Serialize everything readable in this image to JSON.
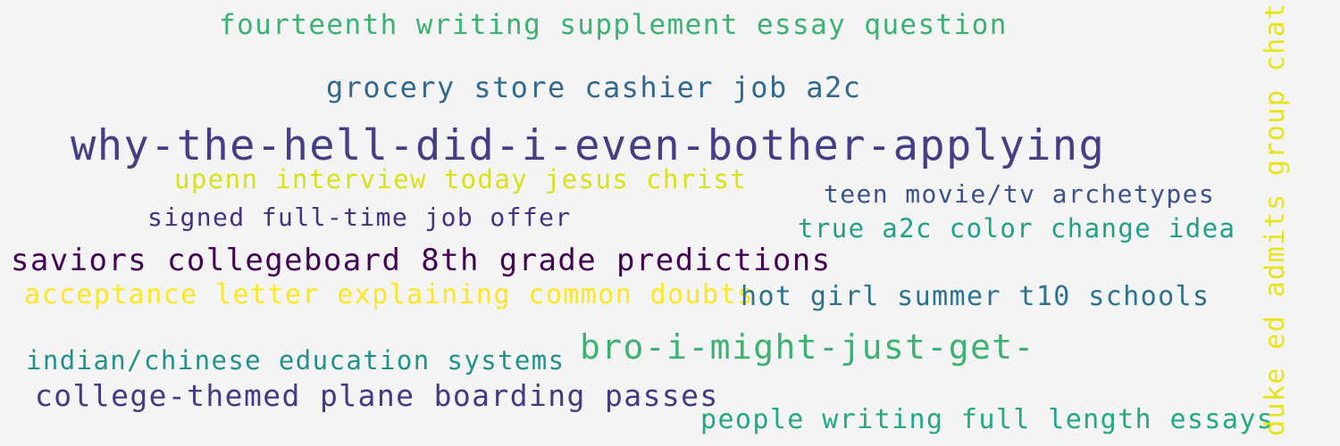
{
  "words": [
    {
      "text": "fourteenth writing supplement essay question",
      "color": "#3bb273"
    },
    {
      "text": "grocery store cashier job a2c",
      "color": "#31688e"
    },
    {
      "text": "why-the-hell-did-i-even-bother-applying",
      "color": "#433e85"
    },
    {
      "text": "upenn interview today jesus christ",
      "color": "#d8e219"
    },
    {
      "text": "teen movie/tv archetypes",
      "color": "#3b528b"
    },
    {
      "text": "signed full-time job offer",
      "color": "#46327e"
    },
    {
      "text": "true a2c color change idea",
      "color": "#1fa187"
    },
    {
      "text": "saviors collegeboard 8th grade predictions",
      "color": "#440154"
    },
    {
      "text": "acceptance letter explaining common doubts",
      "color": "#fde725"
    },
    {
      "text": "hot girl summer t10 schools",
      "color": "#2c728e"
    },
    {
      "text": "bro-i-might-just-get-",
      "color": "#3bb273"
    },
    {
      "text": "indian/chinese education systems",
      "color": "#21918c"
    },
    {
      "text": "college-themed plane boarding passes",
      "color": "#443983"
    },
    {
      "text": "people writing full length essays",
      "color": "#22a884"
    },
    {
      "text": "duke ed admits group chat",
      "color": "#e7e419"
    }
  ]
}
